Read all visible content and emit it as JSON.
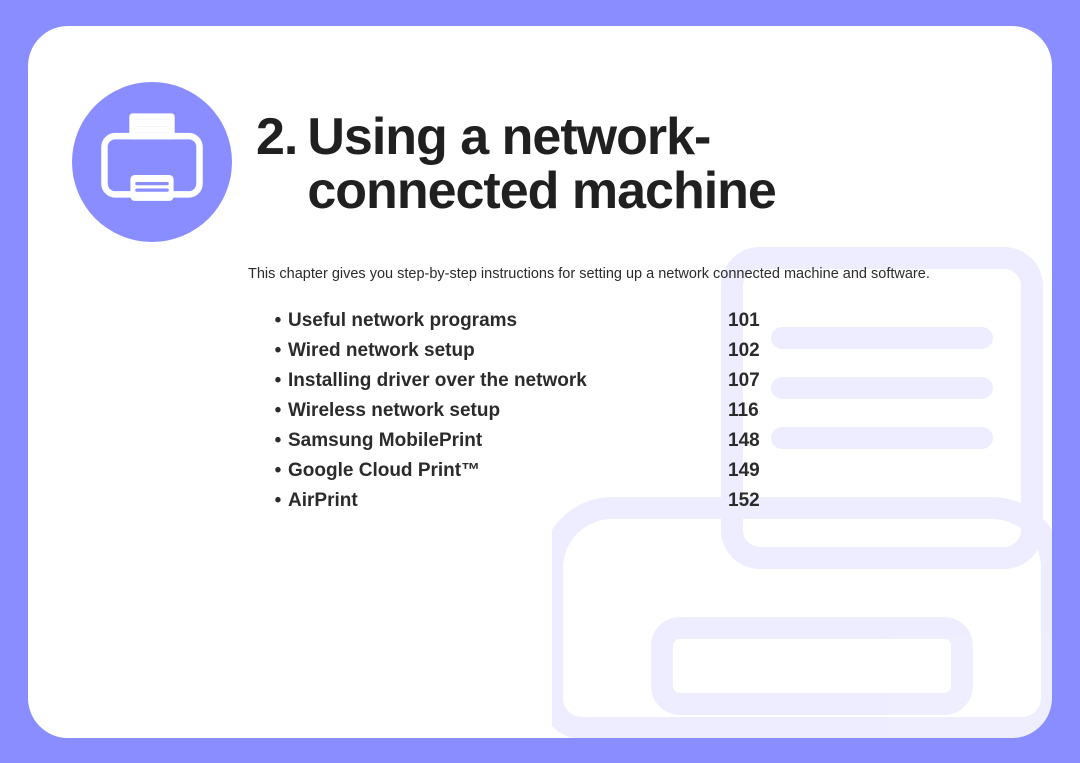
{
  "chapter_number": "2.",
  "chapter_title": "Using a network-connected machine",
  "subtitle": "This chapter gives you step-by-step instructions for setting up a network connected machine and software.",
  "toc": [
    {
      "label": "Useful network programs",
      "page": "101"
    },
    {
      "label": "Wired network setup",
      "page": "102"
    },
    {
      "label": "Installing driver over the network",
      "page": "107"
    },
    {
      "label": "Wireless network setup",
      "page": "116"
    },
    {
      "label": "Samsung MobilePrint",
      "page": "148"
    },
    {
      "label": "Google Cloud Print™",
      "page": "149"
    },
    {
      "label": "AirPrint",
      "page": "152"
    }
  ],
  "colors": {
    "accent": "#8a8dff",
    "text": "#2b2b2b",
    "bg": "#ffffff"
  }
}
